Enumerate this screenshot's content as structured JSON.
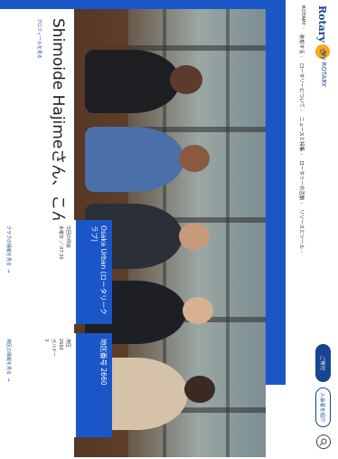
{
  "header": {
    "logo_text": "Rotary",
    "my_rotary": "My ROTARY",
    "nav": [
      "ROTARY",
      "参加する",
      "ロータリーについて",
      "ニュースと特集",
      "ロータリーの活動",
      "リソースとツール"
    ],
    "donate_button": "ご寄付",
    "join_button": "入会者を紹介"
  },
  "hero": {
    "greeting": "Shimoide Hajimeさん、こんにちは",
    "profile_link": "プロフィールを見る"
  },
  "cards": [
    {
      "title": "Osaka Urban (ロータリークラブ)",
      "lines": [
        "次回の例会",
        "水曜日 ／ 07:30"
      ],
      "link": "クラブの情報を見る"
    },
    {
      "title": "地区番号 2660",
      "lines": [
        "地区",
        "2660",
        "ガバナー",
        "3"
      ],
      "link": "地区の情報を見る"
    }
  ],
  "colors": {
    "brand_blue": "#17458f",
    "hero_blue": "#1a56c8",
    "gold": "#f7a81b"
  },
  "icons": {
    "search": "search-icon",
    "chevron": "chevron-down-icon",
    "arrow": "arrow-right-icon"
  }
}
